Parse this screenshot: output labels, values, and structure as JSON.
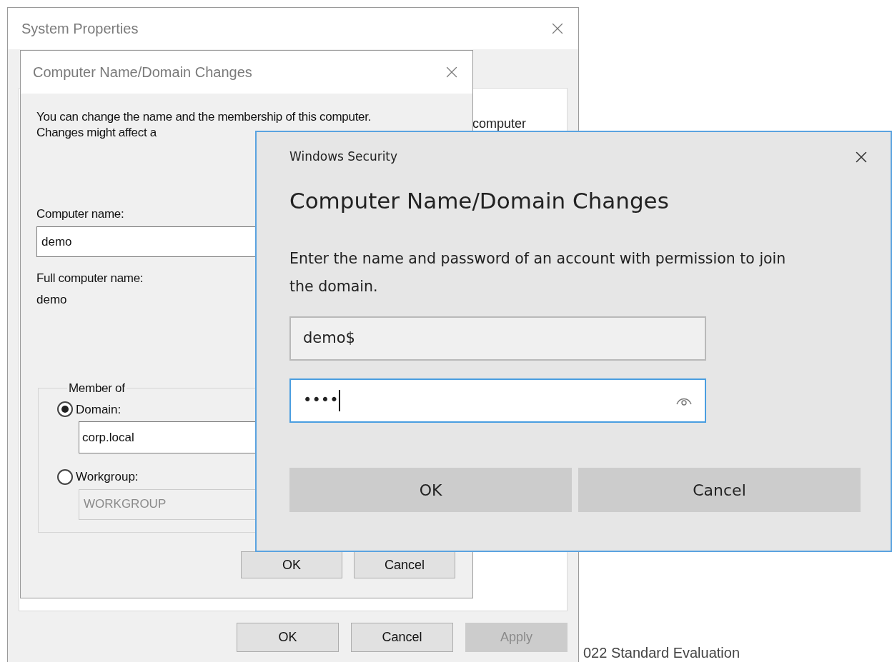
{
  "desktop_text": "022 Standard Evaluation",
  "system_properties": {
    "title": "System Properties",
    "panel_text": "computer",
    "buttons": [
      {
        "label": "OK",
        "disabled": false
      },
      {
        "label": "Cancel",
        "disabled": false
      },
      {
        "label": "Apply",
        "disabled": true
      }
    ]
  },
  "name_dialog": {
    "title": "Computer Name/Domain Changes",
    "description": "You can change the name and the membership of this computer. Changes might affect a",
    "computer_name_label": "Computer name:",
    "computer_name": "demo",
    "full_name_label": "Full computer name:",
    "full_name": "demo",
    "member_of": {
      "legend": "Member of",
      "options": [
        {
          "label": "Domain:",
          "selected": true,
          "value": "corp.local",
          "disabled": false
        },
        {
          "label": "Workgroup:",
          "selected": false,
          "value": "WORKGROUP",
          "disabled": true
        }
      ]
    },
    "buttons": [
      {
        "label": "OK"
      },
      {
        "label": "Cancel"
      }
    ]
  },
  "security_dialog": {
    "app_title": "Windows Security",
    "heading": "Computer Name/Domain Changes",
    "message": "Enter the name and password of an account with permission to join the domain.",
    "username": {
      "value": "demo$"
    },
    "password": {
      "value": "••••",
      "focused": true
    },
    "buttons": [
      {
        "label": "OK"
      },
      {
        "label": "Cancel"
      }
    ]
  }
}
